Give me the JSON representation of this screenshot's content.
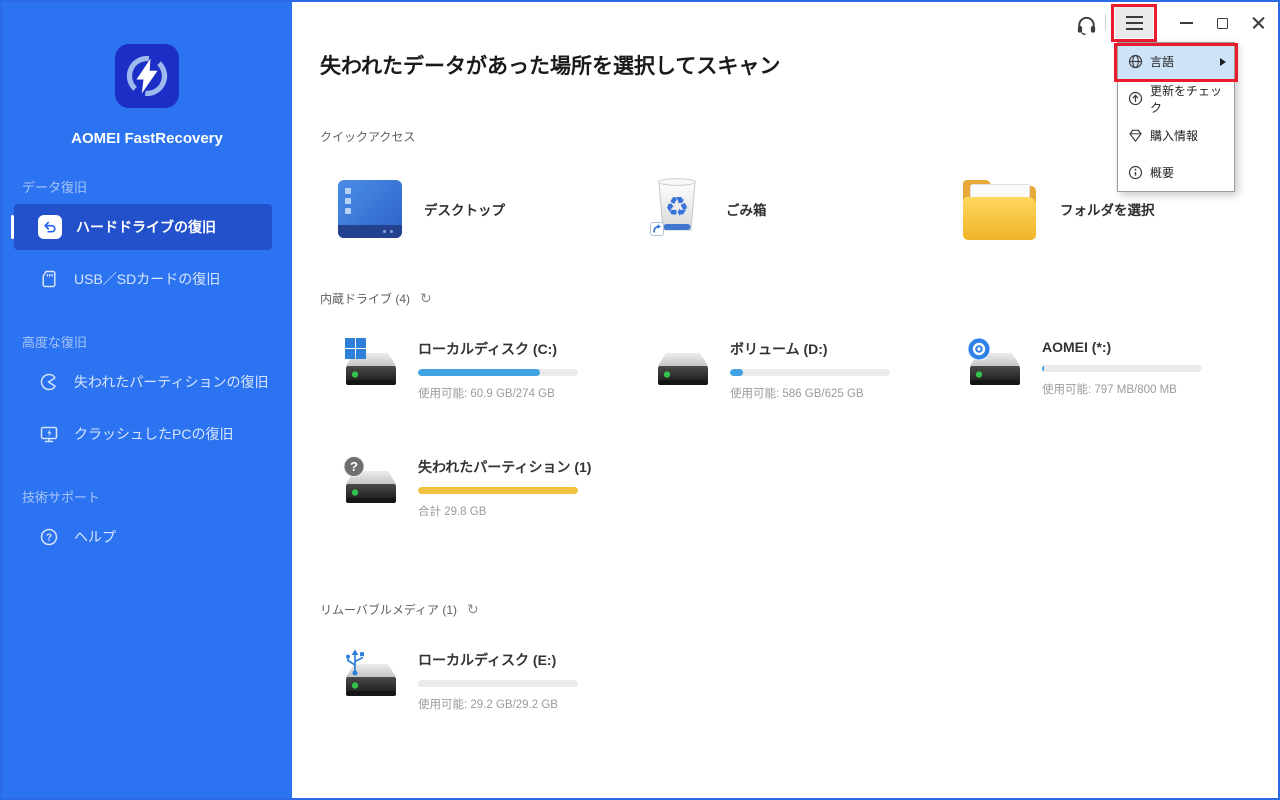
{
  "sidebar": {
    "app_name": "AOMEI FastRecovery",
    "sections": [
      {
        "label": "データ復旧",
        "items": [
          {
            "label": "ハードドライブの復旧",
            "active": true
          },
          {
            "label": "USB／SDカードの復旧",
            "active": false
          }
        ]
      },
      {
        "label": "高度な復旧",
        "items": [
          {
            "label": "失われたパーティションの復旧",
            "active": false
          },
          {
            "label": "クラッシュしたPCの復旧",
            "active": false
          }
        ]
      },
      {
        "label": "技術サポート",
        "items": [
          {
            "label": "ヘルプ",
            "active": false
          }
        ]
      }
    ]
  },
  "header": {
    "title": "失われたデータがあった場所を選択してスキャン"
  },
  "quick_access": {
    "label": "クイックアクセス",
    "items": [
      {
        "label": "デスクトップ"
      },
      {
        "label": "ごみ箱"
      },
      {
        "label": "フォルダを選択"
      }
    ]
  },
  "internal_drives": {
    "label": "内蔵ドライブ (4)",
    "drives": [
      {
        "name": "ローカルディスク (C:)",
        "info": "使用可能: 60.9 GB/274 GB",
        "bar_percent": 76,
        "bar_color": "#41a3e3",
        "badge": "windows"
      },
      {
        "name": "ボリューム (D:)",
        "info": "使用可能: 586 GB/625 GB",
        "bar_percent": 8,
        "bar_color": "#41a3e3",
        "badge": "none"
      },
      {
        "name": "AOMEI (*:)",
        "info": "使用可能: 797 MB/800 MB",
        "bar_percent": 1,
        "bar_color": "#41a3e3",
        "badge": "aomei"
      },
      {
        "name": "失われたパーティション (1)",
        "info": "合計 29.8 GB",
        "bar_percent": 100,
        "bar_color": "#f2c13d",
        "badge": "question"
      }
    ]
  },
  "removable_media": {
    "label": "リムーバブルメディア (1)",
    "drives": [
      {
        "name": "ローカルディスク (E:)",
        "info": "使用可能: 29.2 GB/29.2 GB",
        "bar_percent": 0,
        "bar_color": "#41a3e3",
        "badge": "usb"
      }
    ]
  },
  "menu": {
    "items": [
      {
        "label": "言語",
        "has_submenu": true,
        "highlighted": true
      },
      {
        "label": "更新をチェック"
      },
      {
        "label": "購入情報"
      },
      {
        "label": "概要"
      }
    ]
  },
  "icons": {
    "refresh": "↻",
    "recycle": "♻"
  },
  "colors": {
    "sidebar_blue": "#2b73f1",
    "active_item_blue": "#2351cb",
    "window_border_blue": "#2a6ae6",
    "annotation_red": "#e81c2c",
    "bar_blue": "#41a3e3",
    "bar_yellow": "#f2c13d",
    "bar_track": "#ebebeb",
    "led_green": "#33c24d"
  }
}
